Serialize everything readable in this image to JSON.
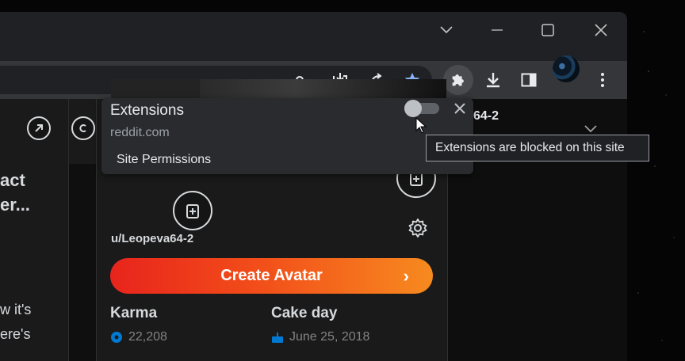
{
  "colors": {
    "accent_blue": "#8ab4f8",
    "create_gradient_start": "#e8241c",
    "create_gradient_end": "#f78a1f",
    "stat_icon_blue": "#0079d3"
  },
  "toolbar": {
    "icons": [
      "key-icon",
      "install-icon",
      "share-icon",
      "bookmark-star-icon",
      "extensions-puzzle-icon",
      "download-icon",
      "side-panel-icon",
      "profile-avatar",
      "menu-icon"
    ]
  },
  "page": {
    "headline_line1": "act",
    "headline_line2": "er...",
    "body_line1": "w it's",
    "body_line2": "ere's",
    "right_fragment": "64-2"
  },
  "profile": {
    "username": "u/Leopeva64-2",
    "create_avatar_label": "Create Avatar",
    "create_avatar_chevron": "›",
    "karma_label": "Karma",
    "karma_value": "22,208",
    "cakeday_label": "Cake day",
    "cakeday_value": "June 25, 2018"
  },
  "extensions_popup": {
    "title": "Extensions",
    "site": "reddit.com",
    "site_permissions": "Site Permissions",
    "toggle_on": false
  },
  "tooltip": {
    "text": "Extensions are blocked on this site"
  }
}
